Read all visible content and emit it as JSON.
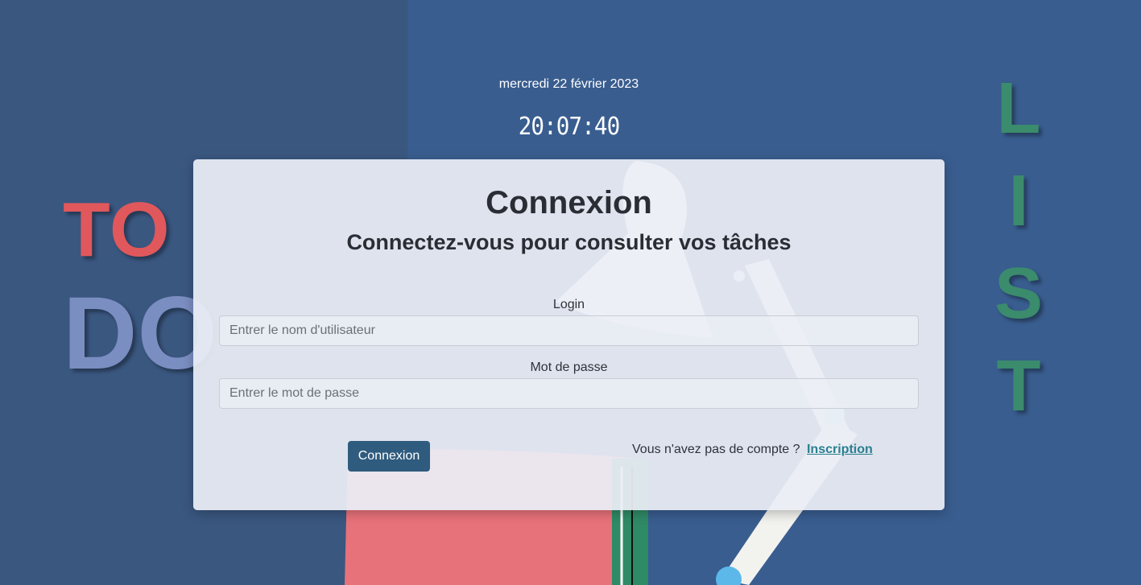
{
  "header": {
    "date": "mercredi 22 février 2023",
    "clock": "20:07:40"
  },
  "decor": {
    "to": "TO",
    "do": "DO",
    "list": [
      "L",
      "I",
      "S",
      "T"
    ]
  },
  "login_card": {
    "title": "Connexion",
    "subtitle": "Connectez-vous pour consulter vos tâches",
    "login_label": "Login",
    "login_placeholder": "Entrer le nom d'utilisateur",
    "login_value": "",
    "password_label": "Mot de passe",
    "password_placeholder": "Entrer le mot de passe",
    "password_value": "",
    "submit_label": "Connexion",
    "no_account_text": "Vous n'avez pas de compte ?",
    "signup_link": "Inscription"
  },
  "colors": {
    "background": "#395d8f",
    "left_panel": "#3a5780",
    "to_red": "#e0585c",
    "do_blue": "#7b8ec2",
    "list_green": "#3b8b6d",
    "button": "#2f5b7e",
    "link": "#2a7f8f"
  }
}
